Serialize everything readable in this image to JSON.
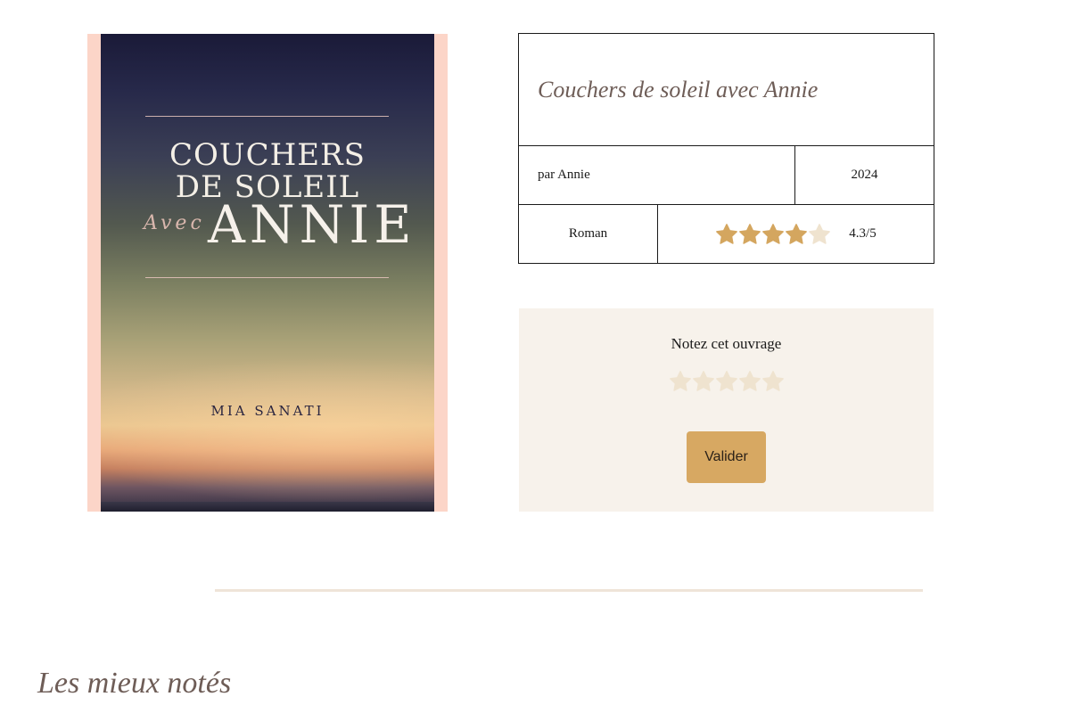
{
  "book": {
    "cover": {
      "title_lines": "COUCHERS DE SOLEIL",
      "title_avec": "Avec",
      "title_name": "ANNIE",
      "author": "MIA SANATI"
    },
    "title": "Couchers de soleil avec Annie",
    "author": "par Annie",
    "year": "2024",
    "genre": "Roman",
    "rating": 4.3,
    "rating_text": "4.3/5"
  },
  "rate": {
    "label": "Notez cet ouvrage",
    "star_count": 5,
    "submit_label": "Valider"
  },
  "section": {
    "title": "Les mieux notés"
  },
  "colors": {
    "accent": "#d7a862",
    "star_filled": "#d4a65f",
    "star_empty": "#efe3cf",
    "title_text": "#6e5d57",
    "rate_bg": "#f7f2eb",
    "divider": "#efe4d8"
  }
}
